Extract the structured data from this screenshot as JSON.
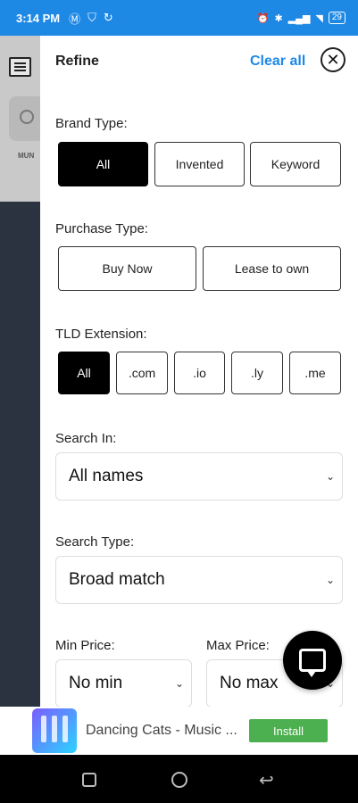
{
  "status_bar": {
    "time": "3:14 PM",
    "left_icons": [
      "notification-m-icon",
      "shield-icon",
      "sync-icon"
    ],
    "right_icons": [
      "alarm-icon",
      "bluetooth-icon",
      "signal-icon",
      "wifi-icon"
    ],
    "battery": "29"
  },
  "background": {
    "label": "MUN"
  },
  "refine_panel": {
    "title": "Refine",
    "clear_all": "Clear all",
    "close_icon": "✕",
    "brand_type": {
      "label": "Brand Type:",
      "options": [
        "All",
        "Invented",
        "Keyword"
      ],
      "selected": "All"
    },
    "purchase_type": {
      "label": "Purchase Type:",
      "options": [
        "Buy Now",
        "Lease to own"
      ]
    },
    "tld_extension": {
      "label": "TLD Extension:",
      "options": [
        "All",
        ".com",
        ".io",
        ".ly",
        ".me"
      ],
      "selected": "All"
    },
    "search_in": {
      "label": "Search In:",
      "value": "All names"
    },
    "search_type": {
      "label": "Search Type:",
      "value": "Broad match"
    },
    "min_price": {
      "label": "Min Price:",
      "value": "No min"
    },
    "max_price": {
      "label": "Max Price:",
      "value": "No max"
    }
  },
  "ad": {
    "title": "Dancing Cats - Music ...",
    "install": "Install"
  },
  "colors": {
    "accent": "#1e88e5",
    "selected": "#000000",
    "install_button": "#4caf50"
  }
}
